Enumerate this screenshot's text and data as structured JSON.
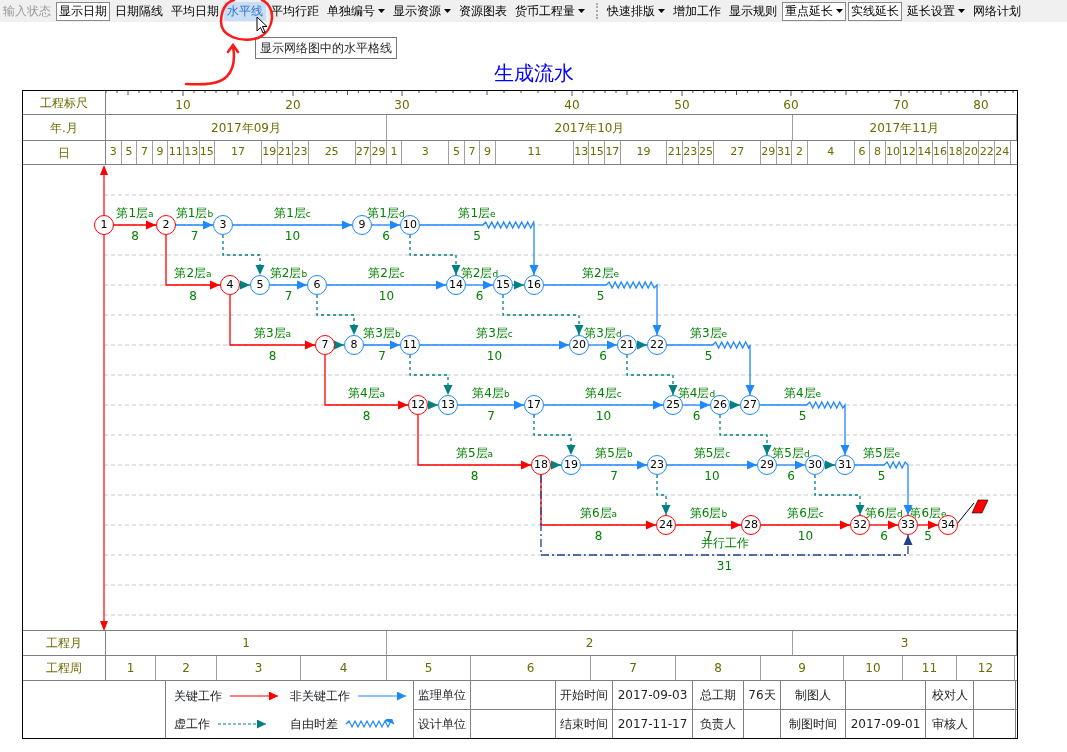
{
  "toolbar": {
    "groups": [
      [
        {
          "label": "输入状态",
          "dropdown": false,
          "disabled": true,
          "pressed": false,
          "hovered": false
        },
        {
          "label": "显示日期",
          "dropdown": false,
          "disabled": false,
          "pressed": true,
          "hovered": false
        },
        {
          "label": "日期隔线",
          "dropdown": false,
          "disabled": false,
          "pressed": false,
          "hovered": false
        },
        {
          "label": "平均日期",
          "dropdown": false,
          "disabled": false,
          "pressed": false,
          "hovered": false
        },
        {
          "label": "水平线",
          "dropdown": false,
          "disabled": false,
          "pressed": false,
          "hovered": true
        },
        {
          "label": "平均行距",
          "dropdown": false,
          "disabled": false,
          "pressed": false,
          "hovered": false
        },
        {
          "label": "单独编号",
          "dropdown": true,
          "disabled": false,
          "pressed": false,
          "hovered": false
        },
        {
          "label": "显示资源",
          "dropdown": true,
          "disabled": false,
          "pressed": false,
          "hovered": false
        },
        {
          "label": "资源图表",
          "dropdown": false,
          "disabled": false,
          "pressed": false,
          "hovered": false
        },
        {
          "label": "货币工程量",
          "dropdown": true,
          "disabled": false,
          "pressed": false,
          "hovered": false
        }
      ],
      [
        {
          "label": "快速排版",
          "dropdown": true,
          "disabled": false,
          "pressed": false,
          "hovered": false
        },
        {
          "label": "增加工作",
          "dropdown": false,
          "disabled": false,
          "pressed": false,
          "hovered": false
        },
        {
          "label": "显示规则",
          "dropdown": false,
          "disabled": false,
          "pressed": false,
          "hovered": false
        },
        {
          "label": "重点延长",
          "dropdown": true,
          "disabled": false,
          "pressed": true,
          "hovered": false
        },
        {
          "label": "实线延长",
          "dropdown": false,
          "disabled": false,
          "pressed": true,
          "hovered": false
        },
        {
          "label": "延长设置",
          "dropdown": true,
          "disabled": false,
          "pressed": false,
          "hovered": false
        },
        {
          "label": "网络计划",
          "dropdown": false,
          "disabled": false,
          "pressed": false,
          "hovered": false
        }
      ]
    ]
  },
  "tooltip": "显示网络图中的水平格线",
  "chart_title": "生成流水",
  "ruler": {
    "label": "工程标尺",
    "ticks": [
      "10",
      "20",
      "30",
      "40",
      "50",
      "60",
      "70",
      "80"
    ]
  },
  "months": {
    "label": "年.月",
    "cells": [
      "2017年09月",
      "2017年10月",
      "2017年11月"
    ]
  },
  "days": {
    "label": "日",
    "cells": [
      "3",
      "5",
      "7",
      "9",
      "11",
      "13",
      "15",
      "17",
      "19",
      "21",
      "23",
      "25",
      "27",
      "29",
      "1",
      "3",
      "5",
      "7",
      "9",
      "11",
      "13",
      "15",
      "17",
      "19",
      "21",
      "23",
      "25",
      "27",
      "29",
      "31",
      "2",
      "4",
      "6",
      "8",
      "10",
      "12",
      "14",
      "16",
      "18",
      "20",
      "22",
      "24"
    ]
  },
  "nodes": [
    {
      "label": "1",
      "critical": true
    },
    {
      "label": "2",
      "critical": true
    },
    {
      "label": "3",
      "critical": false
    },
    {
      "label": "4",
      "critical": true
    },
    {
      "label": "5",
      "critical": false
    },
    {
      "label": "6",
      "critical": false
    },
    {
      "label": "7",
      "critical": true
    },
    {
      "label": "8",
      "critical": false
    },
    {
      "label": "9",
      "critical": false
    },
    {
      "label": "10",
      "critical": false
    },
    {
      "label": "11",
      "critical": false
    },
    {
      "label": "12",
      "critical": true
    },
    {
      "label": "13",
      "critical": false
    },
    {
      "label": "14",
      "critical": false
    },
    {
      "label": "15",
      "critical": false
    },
    {
      "label": "16",
      "critical": false
    },
    {
      "label": "17",
      "critical": false
    },
    {
      "label": "18",
      "critical": true
    },
    {
      "label": "19",
      "critical": false
    },
    {
      "label": "20",
      "critical": false
    },
    {
      "label": "21",
      "critical": false
    },
    {
      "label": "22",
      "critical": false
    },
    {
      "label": "23",
      "critical": false
    },
    {
      "label": "24",
      "critical": true
    },
    {
      "label": "25",
      "critical": false
    },
    {
      "label": "26",
      "critical": false
    },
    {
      "label": "27",
      "critical": false
    },
    {
      "label": "28",
      "critical": true
    },
    {
      "label": "29",
      "critical": false
    },
    {
      "label": "30",
      "critical": false
    },
    {
      "label": "31",
      "critical": false
    },
    {
      "label": "32",
      "critical": true
    },
    {
      "label": "33",
      "critical": true
    },
    {
      "label": "34",
      "critical": true
    }
  ],
  "activities": [
    {
      "name": "第1层$_{a}$",
      "duration": "8",
      "kind": "critical",
      "free_float": false
    },
    {
      "name": "第1层$_{b}$",
      "duration": "7",
      "kind": "normal",
      "free_float": false
    },
    {
      "name": "第1层$_{c}$",
      "duration": "10",
      "kind": "normal",
      "free_float": false
    },
    {
      "name": "第1层$_{d}$",
      "duration": "6",
      "kind": "normal",
      "free_float": false
    },
    {
      "name": "第1层$_{e}$",
      "duration": "5",
      "kind": "normal",
      "free_float": true
    },
    {
      "name": "第2层$_{a}$",
      "duration": "8",
      "kind": "critical",
      "free_float": false
    },
    {
      "name": "第2层$_{b}$",
      "duration": "7",
      "kind": "normal",
      "free_float": false
    },
    {
      "name": "第2层$_{c}$",
      "duration": "10",
      "kind": "normal",
      "free_float": false
    },
    {
      "name": "第2层$_{d}$",
      "duration": "6",
      "kind": "normal",
      "free_float": false
    },
    {
      "name": "第2层$_{e}$",
      "duration": "5",
      "kind": "normal",
      "free_float": true
    },
    {
      "name": "第3层$_{a}$",
      "duration": "8",
      "kind": "critical",
      "free_float": false
    },
    {
      "name": "第3层$_{b}$",
      "duration": "7",
      "kind": "normal",
      "free_float": false
    },
    {
      "name": "第3层$_{c}$",
      "duration": "10",
      "kind": "normal",
      "free_float": false
    },
    {
      "name": "第3层$_{d}$",
      "duration": "6",
      "kind": "normal",
      "free_float": false
    },
    {
      "name": "第3层$_{e}$",
      "duration": "5",
      "kind": "normal",
      "free_float": true
    },
    {
      "name": "第4层$_{a}$",
      "duration": "8",
      "kind": "critical",
      "free_float": false
    },
    {
      "name": "第4层$_{b}$",
      "duration": "7",
      "kind": "normal",
      "free_float": false
    },
    {
      "name": "第4层$_{c}$",
      "duration": "10",
      "kind": "normal",
      "free_float": false
    },
    {
      "name": "第4层$_{d}$",
      "duration": "6",
      "kind": "normal",
      "free_float": false
    },
    {
      "name": "第4层$_{e}$",
      "duration": "5",
      "kind": "normal",
      "free_float": true
    },
    {
      "name": "第5层$_{a}$",
      "duration": "8",
      "kind": "critical",
      "free_float": false
    },
    {
      "name": "第5层$_{b}$",
      "duration": "7",
      "kind": "normal",
      "free_float": false
    },
    {
      "name": "第5层$_{c}$",
      "duration": "10",
      "kind": "normal",
      "free_float": false
    },
    {
      "name": "第5层$_{d}$",
      "duration": "6",
      "kind": "normal",
      "free_float": false
    },
    {
      "name": "第5层$_{e}$",
      "duration": "5",
      "kind": "normal",
      "free_float": true
    },
    {
      "name": "第6层$_{a}$",
      "duration": "8",
      "kind": "critical",
      "free_float": false
    },
    {
      "name": "第6层$_{b}$",
      "duration": "7",
      "kind": "critical",
      "free_float": false
    },
    {
      "name": "第6层$_{c}$",
      "duration": "10",
      "kind": "critical",
      "free_float": false
    },
    {
      "name": "第6层$_{d}$",
      "duration": "6",
      "kind": "critical",
      "free_float": false
    },
    {
      "name": "第6层$_{e}$",
      "duration": "5",
      "kind": "critical",
      "free_float": false
    },
    {
      "name": "并行工作",
      "duration": "31",
      "kind": "parallel",
      "free_float": false
    }
  ],
  "project_months": {
    "label": "工程月",
    "cells": [
      "1",
      "2",
      "3"
    ]
  },
  "project_weeks": {
    "label": "工程周",
    "cells": [
      "1",
      "2",
      "3",
      "4",
      "5",
      "6",
      "7",
      "8",
      "9",
      "10",
      "11",
      "12"
    ]
  },
  "legend": [
    {
      "label": "关键工作",
      "kind": "critical"
    },
    {
      "label": "非关键工作",
      "kind": "normal"
    },
    {
      "label": "虚工作",
      "kind": "dummy"
    },
    {
      "label": "自由时差",
      "kind": "float"
    }
  ],
  "info_table": [
    [
      {
        "label": "监理单位"
      },
      {
        "label": "开始时间",
        "value": "2017-09-03"
      },
      {
        "label": "总工期",
        "value": "76天"
      },
      {
        "label": "制图人"
      },
      {
        "label": "校对人"
      }
    ],
    [
      {
        "label": "设计单位"
      },
      {
        "label": "结束时间",
        "value": "2017-11-17"
      },
      {
        "label": "负责人"
      },
      {
        "label": "制图时间",
        "value": "2017-09-01"
      },
      {
        "label": "审核人"
      }
    ]
  ]
}
